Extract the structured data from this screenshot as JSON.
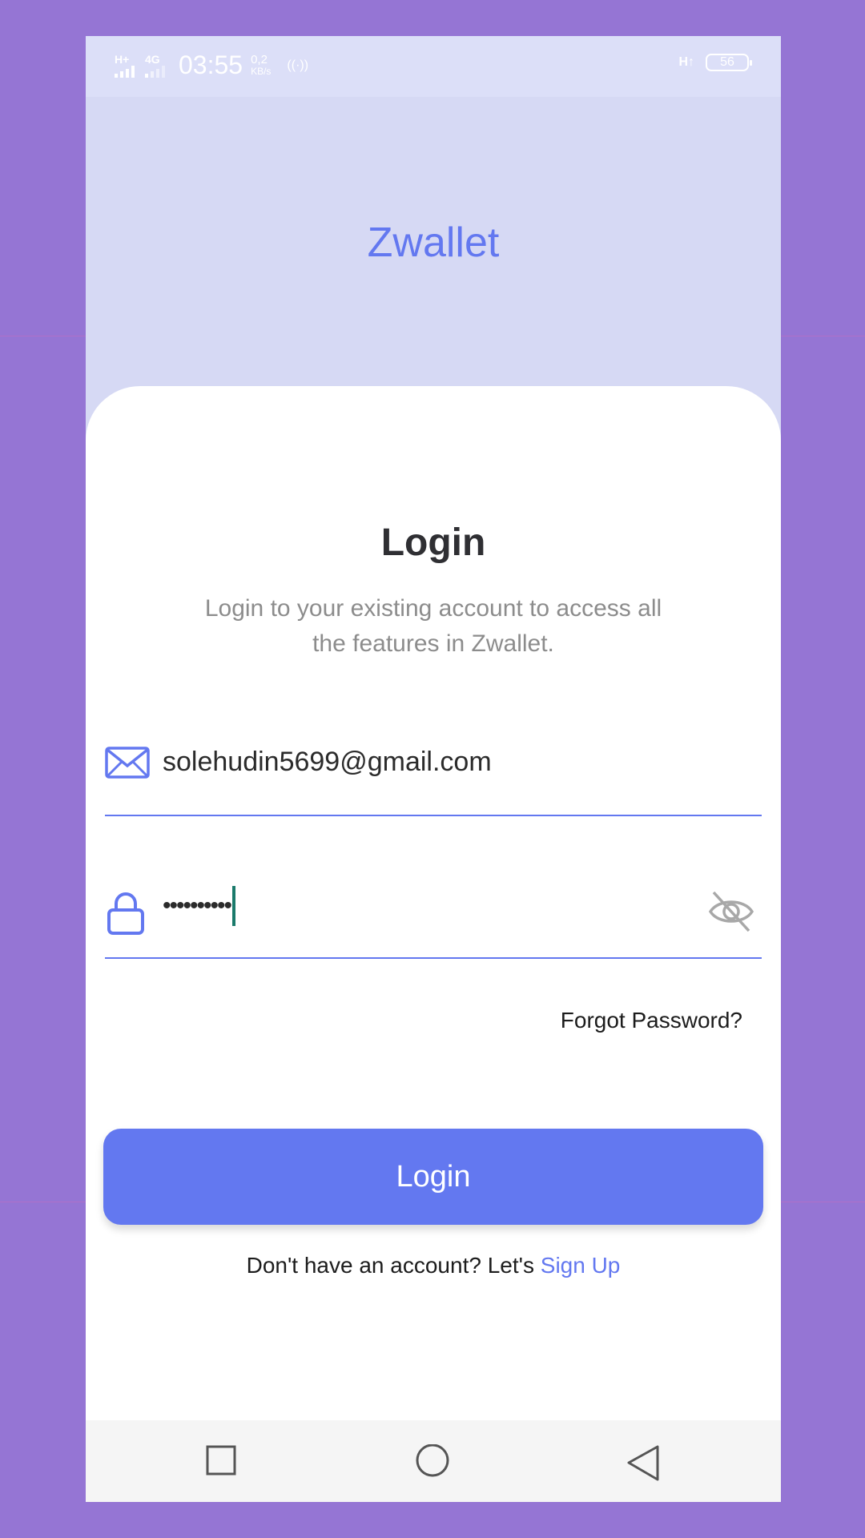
{
  "status_bar": {
    "signal_label_1": "H+",
    "signal_label_2": "4G",
    "time": "03:55",
    "speed_value": "0,2",
    "speed_unit": "KB/s",
    "hotspot_label": "((·))",
    "network_right": "H↑",
    "battery": "56"
  },
  "header": {
    "app_name": "Zwallet"
  },
  "login_card": {
    "title": "Login",
    "subtitle": "Login to your existing account to access all the features in Zwallet.",
    "email": {
      "value": "solehudin5699@gmail.com"
    },
    "password": {
      "value_masked": "••••••••••"
    },
    "forgot_label": "Forgot Password?",
    "button_label": "Login",
    "signup_prompt": "Don't have an account? Let's ",
    "signup_link": "Sign Up"
  },
  "colors": {
    "background": "#9575d4",
    "header_bg": "#d6d9f4",
    "accent": "#6378f0",
    "text_dark": "#2f2f33",
    "text_muted": "#8c8c8c"
  },
  "icons": {
    "email": "mail-icon",
    "password": "lock-icon",
    "visibility": "eye-off-icon",
    "nav_recents": "square-icon",
    "nav_home": "circle-icon",
    "nav_back": "triangle-back-icon"
  }
}
